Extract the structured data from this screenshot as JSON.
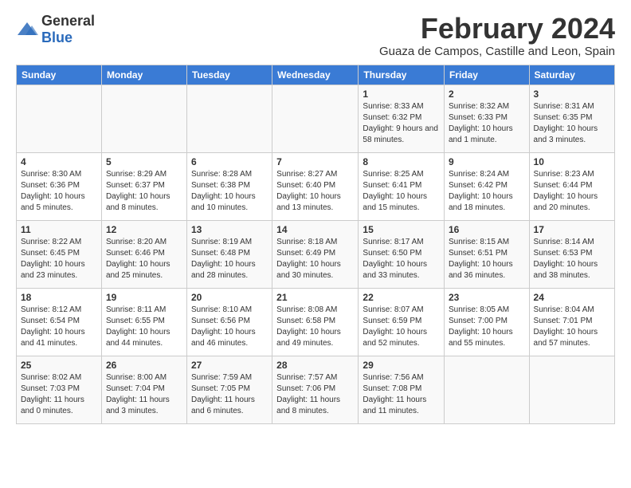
{
  "header": {
    "logo_general": "General",
    "logo_blue": "Blue",
    "title": "February 2024",
    "subtitle": "Guaza de Campos, Castille and Leon, Spain"
  },
  "days_of_week": [
    "Sunday",
    "Monday",
    "Tuesday",
    "Wednesday",
    "Thursday",
    "Friday",
    "Saturday"
  ],
  "weeks": [
    [
      {
        "day": "",
        "info": ""
      },
      {
        "day": "",
        "info": ""
      },
      {
        "day": "",
        "info": ""
      },
      {
        "day": "",
        "info": ""
      },
      {
        "day": "1",
        "info": "Sunrise: 8:33 AM\nSunset: 6:32 PM\nDaylight: 9 hours and 58 minutes."
      },
      {
        "day": "2",
        "info": "Sunrise: 8:32 AM\nSunset: 6:33 PM\nDaylight: 10 hours and 1 minute."
      },
      {
        "day": "3",
        "info": "Sunrise: 8:31 AM\nSunset: 6:35 PM\nDaylight: 10 hours and 3 minutes."
      }
    ],
    [
      {
        "day": "4",
        "info": "Sunrise: 8:30 AM\nSunset: 6:36 PM\nDaylight: 10 hours and 5 minutes."
      },
      {
        "day": "5",
        "info": "Sunrise: 8:29 AM\nSunset: 6:37 PM\nDaylight: 10 hours and 8 minutes."
      },
      {
        "day": "6",
        "info": "Sunrise: 8:28 AM\nSunset: 6:38 PM\nDaylight: 10 hours and 10 minutes."
      },
      {
        "day": "7",
        "info": "Sunrise: 8:27 AM\nSunset: 6:40 PM\nDaylight: 10 hours and 13 minutes."
      },
      {
        "day": "8",
        "info": "Sunrise: 8:25 AM\nSunset: 6:41 PM\nDaylight: 10 hours and 15 minutes."
      },
      {
        "day": "9",
        "info": "Sunrise: 8:24 AM\nSunset: 6:42 PM\nDaylight: 10 hours and 18 minutes."
      },
      {
        "day": "10",
        "info": "Sunrise: 8:23 AM\nSunset: 6:44 PM\nDaylight: 10 hours and 20 minutes."
      }
    ],
    [
      {
        "day": "11",
        "info": "Sunrise: 8:22 AM\nSunset: 6:45 PM\nDaylight: 10 hours and 23 minutes."
      },
      {
        "day": "12",
        "info": "Sunrise: 8:20 AM\nSunset: 6:46 PM\nDaylight: 10 hours and 25 minutes."
      },
      {
        "day": "13",
        "info": "Sunrise: 8:19 AM\nSunset: 6:48 PM\nDaylight: 10 hours and 28 minutes."
      },
      {
        "day": "14",
        "info": "Sunrise: 8:18 AM\nSunset: 6:49 PM\nDaylight: 10 hours and 30 minutes."
      },
      {
        "day": "15",
        "info": "Sunrise: 8:17 AM\nSunset: 6:50 PM\nDaylight: 10 hours and 33 minutes."
      },
      {
        "day": "16",
        "info": "Sunrise: 8:15 AM\nSunset: 6:51 PM\nDaylight: 10 hours and 36 minutes."
      },
      {
        "day": "17",
        "info": "Sunrise: 8:14 AM\nSunset: 6:53 PM\nDaylight: 10 hours and 38 minutes."
      }
    ],
    [
      {
        "day": "18",
        "info": "Sunrise: 8:12 AM\nSunset: 6:54 PM\nDaylight: 10 hours and 41 minutes."
      },
      {
        "day": "19",
        "info": "Sunrise: 8:11 AM\nSunset: 6:55 PM\nDaylight: 10 hours and 44 minutes."
      },
      {
        "day": "20",
        "info": "Sunrise: 8:10 AM\nSunset: 6:56 PM\nDaylight: 10 hours and 46 minutes."
      },
      {
        "day": "21",
        "info": "Sunrise: 8:08 AM\nSunset: 6:58 PM\nDaylight: 10 hours and 49 minutes."
      },
      {
        "day": "22",
        "info": "Sunrise: 8:07 AM\nSunset: 6:59 PM\nDaylight: 10 hours and 52 minutes."
      },
      {
        "day": "23",
        "info": "Sunrise: 8:05 AM\nSunset: 7:00 PM\nDaylight: 10 hours and 55 minutes."
      },
      {
        "day": "24",
        "info": "Sunrise: 8:04 AM\nSunset: 7:01 PM\nDaylight: 10 hours and 57 minutes."
      }
    ],
    [
      {
        "day": "25",
        "info": "Sunrise: 8:02 AM\nSunset: 7:03 PM\nDaylight: 11 hours and 0 minutes."
      },
      {
        "day": "26",
        "info": "Sunrise: 8:00 AM\nSunset: 7:04 PM\nDaylight: 11 hours and 3 minutes."
      },
      {
        "day": "27",
        "info": "Sunrise: 7:59 AM\nSunset: 7:05 PM\nDaylight: 11 hours and 6 minutes."
      },
      {
        "day": "28",
        "info": "Sunrise: 7:57 AM\nSunset: 7:06 PM\nDaylight: 11 hours and 8 minutes."
      },
      {
        "day": "29",
        "info": "Sunrise: 7:56 AM\nSunset: 7:08 PM\nDaylight: 11 hours and 11 minutes."
      },
      {
        "day": "",
        "info": ""
      },
      {
        "day": "",
        "info": ""
      }
    ]
  ]
}
